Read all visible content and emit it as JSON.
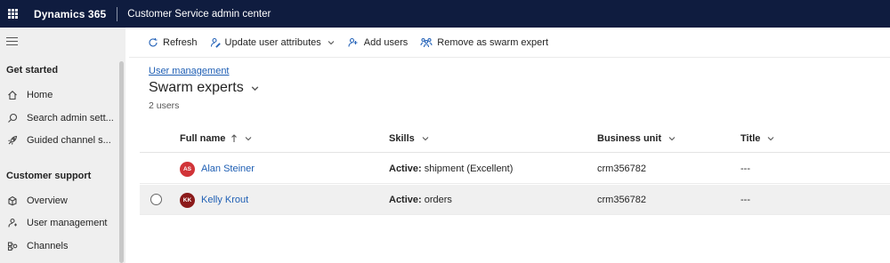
{
  "topbar": {
    "brand": "Dynamics 365",
    "app_title": "Customer Service admin center"
  },
  "sidebar": {
    "sections": [
      {
        "title": "Get started",
        "items": [
          {
            "label": "Home",
            "icon": "home-icon"
          },
          {
            "label": "Search admin sett...",
            "icon": "search-icon"
          },
          {
            "label": "Guided channel s...",
            "icon": "rocket-icon"
          }
        ]
      },
      {
        "title": "Customer support",
        "items": [
          {
            "label": "Overview",
            "icon": "overview-icon"
          },
          {
            "label": "User management",
            "icon": "user-management-icon"
          },
          {
            "label": "Channels",
            "icon": "channels-icon"
          }
        ]
      }
    ]
  },
  "commands": {
    "refresh": "Refresh",
    "update_user_attributes": "Update user attributes",
    "add_users": "Add users",
    "remove_swarm_expert": "Remove as swarm expert"
  },
  "main": {
    "breadcrumb": "User management",
    "view_title": "Swarm experts",
    "record_count": "2 users"
  },
  "grid": {
    "columns": [
      {
        "label": "Full name",
        "sorted": "ascending"
      },
      {
        "label": "Skills"
      },
      {
        "label": "Business unit"
      },
      {
        "label": "Title"
      }
    ],
    "rows": [
      {
        "initials": "AS",
        "avatar_color": "#d13438",
        "name": "Alan Steiner",
        "skill_status": "Active:",
        "skill_value": " shipment (Excellent)",
        "business_unit": "crm356782",
        "title": "---"
      },
      {
        "initials": "KK",
        "avatar_color": "#8b1a1a",
        "name": "Kelly Krout",
        "skill_status": "Active:",
        "skill_value": " orders",
        "business_unit": "crm356782",
        "title": "---"
      }
    ]
  },
  "colors": {
    "topbar_bg": "#0f1c3f",
    "link": "#1f5fb4",
    "accent": "#2563b8"
  }
}
